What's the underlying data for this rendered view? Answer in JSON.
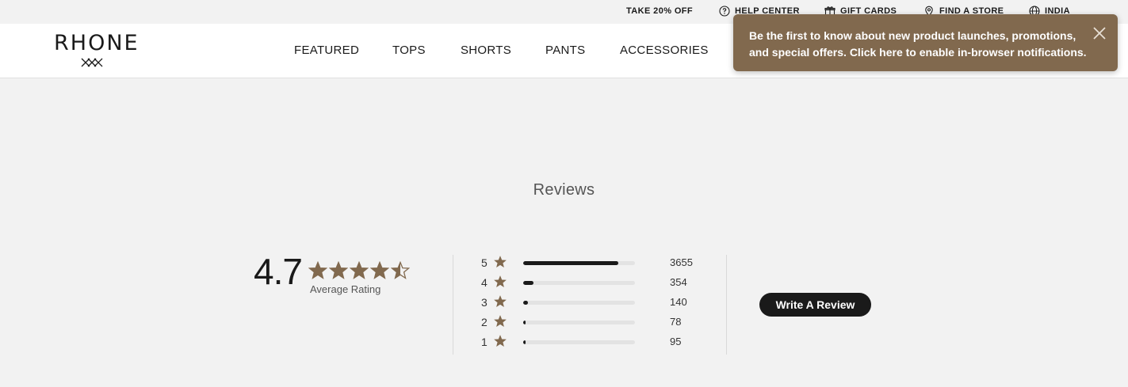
{
  "utility_bar": {
    "promo": "TAKE 20% OFF",
    "help": "HELP CENTER",
    "gift": "GIFT CARDS",
    "store": "FIND A STORE",
    "region": "INDIA"
  },
  "header": {
    "logo": "RHONE",
    "nav": [
      "FEATURED",
      "TOPS",
      "SHORTS",
      "PANTS",
      "ACCESSORIES"
    ]
  },
  "toast": {
    "message": "Be the first to know about new product launches, promotions, and special offers. Click here to enable in-browser notifications.",
    "close_icon": "close-icon"
  },
  "reviews": {
    "title": "Reviews",
    "average": "4.7",
    "average_value": 4.7,
    "average_label": "Average Rating",
    "distribution": [
      {
        "stars": "5",
        "count": "3655",
        "fraction": 0.85
      },
      {
        "stars": "4",
        "count": "354",
        "fraction": 0.09
      },
      {
        "stars": "3",
        "count": "140",
        "fraction": 0.04
      },
      {
        "stars": "2",
        "count": "78",
        "fraction": 0.02
      },
      {
        "stars": "1",
        "count": "95",
        "fraction": 0.02
      }
    ],
    "write_button": "Write A Review"
  },
  "colors": {
    "accent": "#81694e",
    "star": "#81694e",
    "button": "#1a1a1a"
  }
}
